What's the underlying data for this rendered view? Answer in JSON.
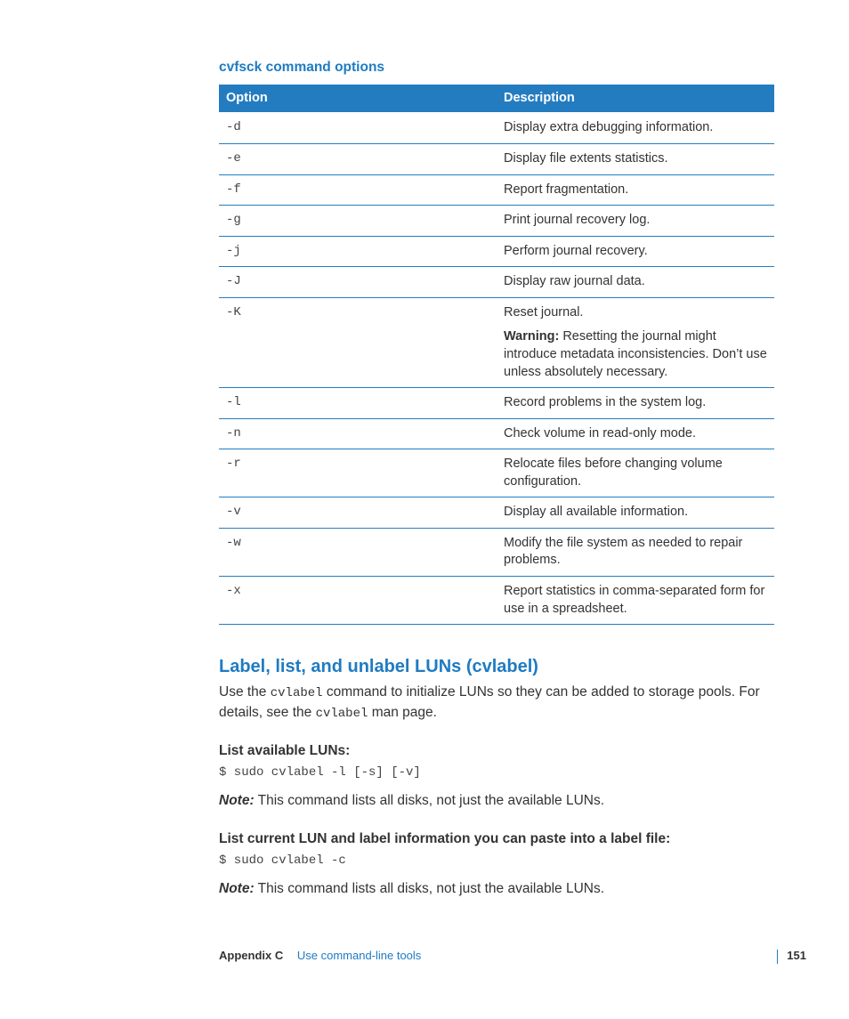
{
  "table_heading": "cvfsck command options",
  "columns": {
    "option": "Option",
    "description": "Description"
  },
  "rows": [
    {
      "opt": "-d",
      "desc": "Display extra debugging information."
    },
    {
      "opt": "-e",
      "desc": "Display file extents statistics."
    },
    {
      "opt": "-f",
      "desc": "Report fragmentation."
    },
    {
      "opt": "-g",
      "desc": "Print journal recovery log."
    },
    {
      "opt": "-j",
      "desc": "Perform journal recovery."
    },
    {
      "opt": "-J",
      "desc": "Display raw journal data."
    },
    {
      "opt": "-K",
      "desc": "Reset journal.",
      "warn_label": "Warning:",
      "warn": "  Resetting the journal might introduce metadata inconsistencies. Don’t use unless absolutely necessary."
    },
    {
      "opt": "-l",
      "desc": "Record problems in the system log."
    },
    {
      "opt": "-n",
      "desc": "Check volume in read-only mode."
    },
    {
      "opt": "-r",
      "desc": "Relocate files before changing volume configuration."
    },
    {
      "opt": "-v",
      "desc": "Display all available information."
    },
    {
      "opt": "-w",
      "desc": "Modify the file system as needed to repair problems."
    },
    {
      "opt": "-x",
      "desc": "Report statistics in comma-separated form for use in a spreadsheet."
    }
  ],
  "section2": {
    "title": "Label, list, and unlabel LUNs (cvlabel)",
    "p1a": "Use the ",
    "p1_code": "cvlabel",
    "p1b": " command to initialize LUNs so they can be added to storage pools. For details, see the ",
    "p1_code2": "cvlabel",
    "p1c": " man page.",
    "sub1": "List available LUNs:",
    "code1": "$ sudo cvlabel -l [-s] [-v]",
    "note_label": "Note:",
    "note1": "  This command lists all disks, not just the available LUNs.",
    "sub2": "List current LUN and label information you can paste into a label file:",
    "code2": "$ sudo cvlabel -c",
    "note2": "  This command lists all disks, not just the available LUNs."
  },
  "footer": {
    "appendix": "Appendix C",
    "link": "Use command-line tools",
    "page": "151"
  }
}
